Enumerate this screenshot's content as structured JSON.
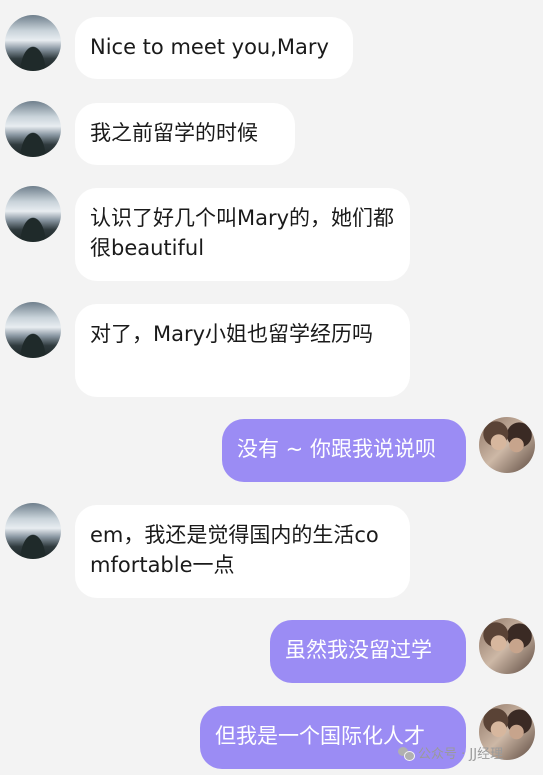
{
  "messages": [
    {
      "side": "left",
      "text": "Nice to meet you,Mary"
    },
    {
      "side": "left",
      "text": "我之前留学的时候"
    },
    {
      "side": "left",
      "text": "认识了好几个叫Mary的，她们都很beautiful"
    },
    {
      "side": "left",
      "text": "对了，Mary小姐也留学经历吗"
    },
    {
      "side": "right",
      "text": "没有 ~ 你跟我说说呗"
    },
    {
      "side": "left",
      "text": "em，我还是觉得国内的生活comfortable一点"
    },
    {
      "side": "right",
      "text": "虽然我没留过学"
    },
    {
      "side": "right",
      "text": "但我是一个国际化人才"
    }
  ],
  "watermark": {
    "text": "公众号 · JJ经理",
    "icon": "wechat-icon"
  },
  "colors": {
    "background": "#f3f3f3",
    "left_bubble": "#ffffff",
    "right_bubble": "#9b8cf4"
  }
}
